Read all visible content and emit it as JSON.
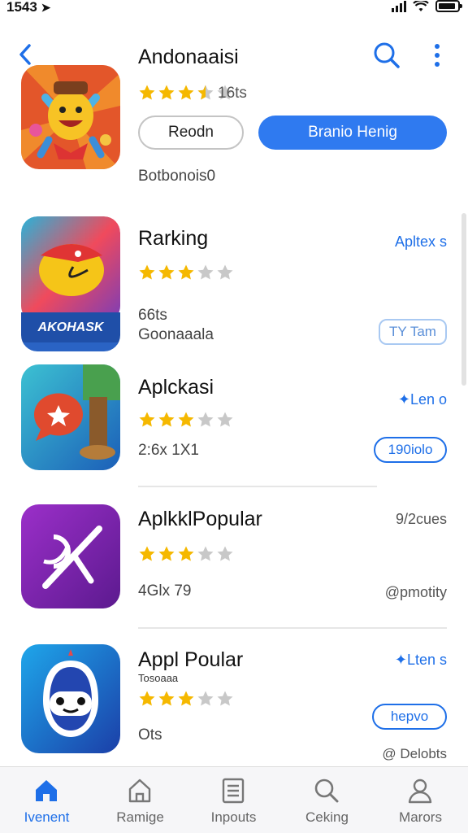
{
  "status_bar": {
    "time": "1543"
  },
  "colors": {
    "accent": "#1e6fe8",
    "star": "#f5b800",
    "star_empty": "#c8c8c8"
  },
  "header_app": {
    "title": "Andonaaisi",
    "rating_text": "16ts",
    "stars": 3.5,
    "secondary_button": "Reodn",
    "primary_button": "Branio Henig",
    "caption": "Botbonois0"
  },
  "apps": [
    {
      "title": "Rarking",
      "stars": 3,
      "line1": "66ts",
      "line2": "Goonaaala",
      "right_link": "Apltex s",
      "button": "TY Tam",
      "icon_caption": "AKOHASK"
    },
    {
      "title": "Aplckasi",
      "stars": 3,
      "line1": "2:6x 1X1",
      "right_link": "Len o",
      "button": "190iolo"
    },
    {
      "title": "AplkklPopular",
      "stars": 3,
      "line1": "4Glx 79",
      "right_top": "9/2cues",
      "right_bottom": "@pmotity"
    },
    {
      "title": "Appl Poular",
      "small_text": "Tosoaaa",
      "stars": 3,
      "line1": "Ots",
      "right_link": "Lten s",
      "button": "hepvo",
      "right_bottom": "@ Delobts"
    }
  ],
  "tabs": [
    {
      "label": "Ivenent",
      "icon": "home-icon",
      "active": true
    },
    {
      "label": "Ramige",
      "icon": "store-icon",
      "active": false
    },
    {
      "label": "Inpouts",
      "icon": "list-icon",
      "active": false
    },
    {
      "label": "Ceking",
      "icon": "search-icon",
      "active": false
    },
    {
      "label": "Marors",
      "icon": "person-icon",
      "active": false
    }
  ]
}
